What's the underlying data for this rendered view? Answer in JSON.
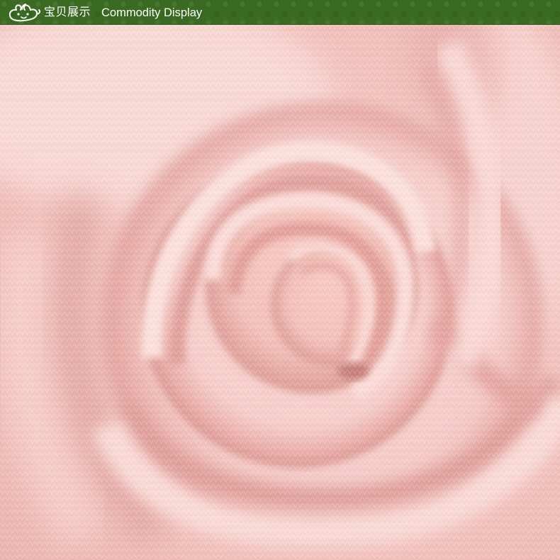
{
  "header": {
    "logo_icon": "mascot-logo-icon",
    "title_cn": "宝贝展示",
    "title_en": "Commodity Display"
  },
  "colors": {
    "header_bg": "#3b6b22",
    "header_text": "#ffffff",
    "fabric_pink": "#f2c4c0",
    "fabric_highlight": "#fbe0dc",
    "fabric_shadow": "#dc9a95"
  }
}
